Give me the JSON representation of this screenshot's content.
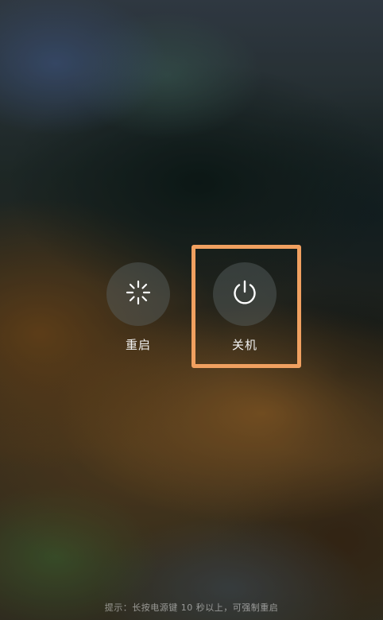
{
  "power_menu": {
    "options": [
      {
        "id": "restart",
        "label": "重启",
        "icon": "restart-icon"
      },
      {
        "id": "shutdown",
        "label": "关机",
        "icon": "power-icon",
        "highlighted": true
      }
    ],
    "highlight_color": "#f0a060"
  },
  "hint": {
    "text": "提示：长按电源键 10 秒以上，可强制重启"
  }
}
